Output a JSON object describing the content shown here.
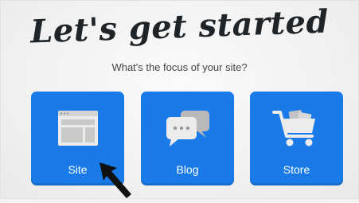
{
  "header": {
    "title": "Let's get started",
    "subtitle": "What's the focus of your site?"
  },
  "options": [
    {
      "label": "Site",
      "icon": "website-layout-icon"
    },
    {
      "label": "Blog",
      "icon": "chat-bubbles-icon"
    },
    {
      "label": "Store",
      "icon": "shopping-cart-icon"
    }
  ],
  "colors": {
    "card": "#1a7be8",
    "background": "#f2f2f2",
    "title": "#1f2429"
  }
}
